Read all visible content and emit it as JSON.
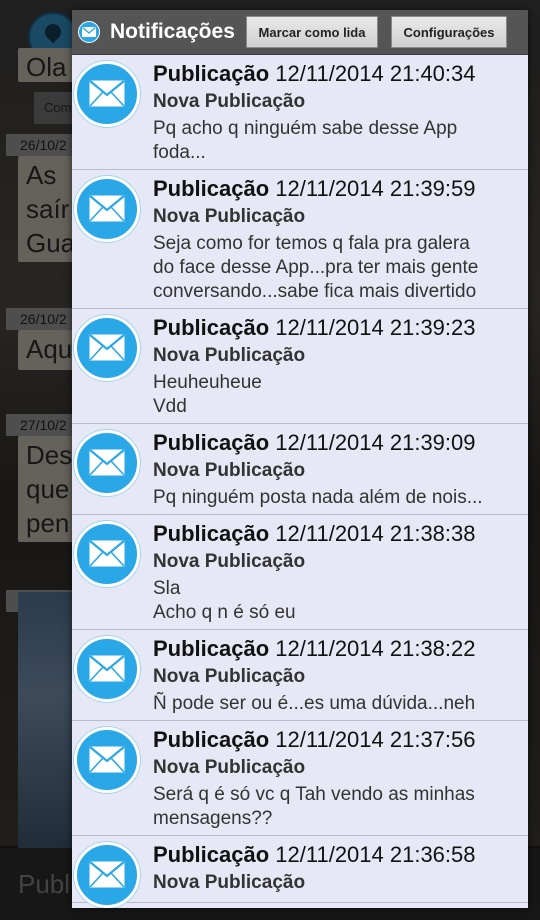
{
  "background": {
    "bubbles": [
      "Ola",
      "As\nsaír\nGua",
      "Aqu",
      "Des\nque\npen"
    ],
    "dates": [
      "26/10/2",
      "26/10/2",
      "27/10/2",
      "27/10/2"
    ],
    "small_button": "Com",
    "compose_placeholder": "Publ"
  },
  "panel": {
    "title": "Notificações",
    "mark_read_label": "Marcar como lida",
    "settings_label": "Configurações"
  },
  "notifications": [
    {
      "kind": "Publicação",
      "timestamp": "12/11/2014 21:40:34",
      "subtitle": "Nova Publicação",
      "body": "Pq acho q ninguém sabe desse App\nfoda..."
    },
    {
      "kind": "Publicação",
      "timestamp": "12/11/2014 21:39:59",
      "subtitle": "Nova Publicação",
      "body": "Seja como for temos q fala pra galera\ndo face desse App...pra ter mais gente\nconversando...sabe fica mais divertido"
    },
    {
      "kind": "Publicação",
      "timestamp": "12/11/2014 21:39:23",
      "subtitle": "Nova Publicação",
      "body": "Heuheuheue\nVdd"
    },
    {
      "kind": "Publicação",
      "timestamp": "12/11/2014 21:39:09",
      "subtitle": "Nova Publicação",
      "body": "Pq ninguém posta nada além de nois..."
    },
    {
      "kind": "Publicação",
      "timestamp": "12/11/2014 21:38:38",
      "subtitle": "Nova Publicação",
      "body": "Sla\nAcho q n é só eu"
    },
    {
      "kind": "Publicação",
      "timestamp": "12/11/2014 21:38:22",
      "subtitle": "Nova Publicação",
      "body": "Ñ pode ser ou é...es uma dúvida...neh"
    },
    {
      "kind": "Publicação",
      "timestamp": "12/11/2014 21:37:56",
      "subtitle": "Nova Publicação",
      "body": "Será q é só vc q Tah vendo as minhas\nmensagens??"
    },
    {
      "kind": "Publicação",
      "timestamp": "12/11/2014 21:36:58",
      "subtitle": "Nova Publicação",
      "body": ""
    }
  ],
  "icons": {
    "header": "envelope-icon",
    "item": "envelope-icon",
    "location": "location-pin-icon"
  },
  "colors": {
    "accent": "#2aa7e6",
    "panel_bg": "#e6e9f5",
    "header_bg": "#555555"
  }
}
